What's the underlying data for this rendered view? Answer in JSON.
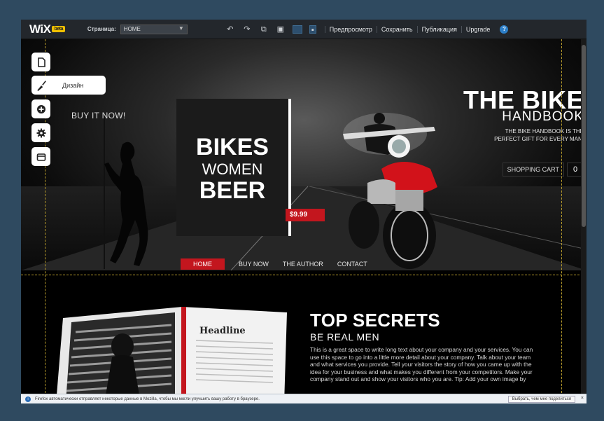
{
  "editor": {
    "logo": "WiX",
    "logo_badge": "beta",
    "page_label": "Страница:",
    "page_select": "HOME",
    "toolbar_icons": [
      "undo-icon",
      "redo-icon",
      "copy-icon",
      "paste-icon",
      "desktop-view-icon",
      "mobile-view-icon"
    ],
    "menu": {
      "preview": "Предпросмотр",
      "save": "Сохранить",
      "publish": "Публикация",
      "upgrade": "Upgrade"
    },
    "help": "?"
  },
  "rail": {
    "design_label": "Дизайн",
    "icons": [
      "pages-icon",
      "design-brush-icon",
      "add-icon",
      "settings-gear-icon",
      "app-market-icon"
    ]
  },
  "hero": {
    "buy_now_sign": "BUY IT NOW!",
    "book_lines": [
      "BIKES",
      "WOMEN",
      "BEER"
    ],
    "price": "$9.99",
    "title": "THE BIKE",
    "subtitle": "HANDBOOK",
    "description": "THE BIKE HANDBOOK IS THE PERFECT GIFT FOR EVERY MAN.",
    "cart_label": "SHOPPING CART",
    "cart_count": "0"
  },
  "site_nav": [
    "HOME",
    "BUY NOW",
    "THE AUTHOR",
    "CONTACT"
  ],
  "section": {
    "book_headline": "Headline",
    "title": "TOP SECRETS",
    "subtitle": "BE REAL MEN",
    "body": "This is a great space to write long text about your company and your services. You can use this space to go into a little more detail about your company. Talk about your team and what services you provide. Tell your visitors the story of how you came up with the idea for your business and what makes you different from your competitors. Make your company stand out and show your visitors who you are. Tip: Add your own image by"
  },
  "notification": {
    "message": "Firefox автоматически отправляет некоторые данные в Mozilla, чтобы мы могли улучшить вашу работу в браузере.",
    "button": "Выбрать, чем мне поделиться",
    "close": "×"
  },
  "colors": {
    "accent_red": "#c3161e",
    "guide_yellow": "#b69a2a",
    "desktop_bg": "#2f4a60"
  }
}
